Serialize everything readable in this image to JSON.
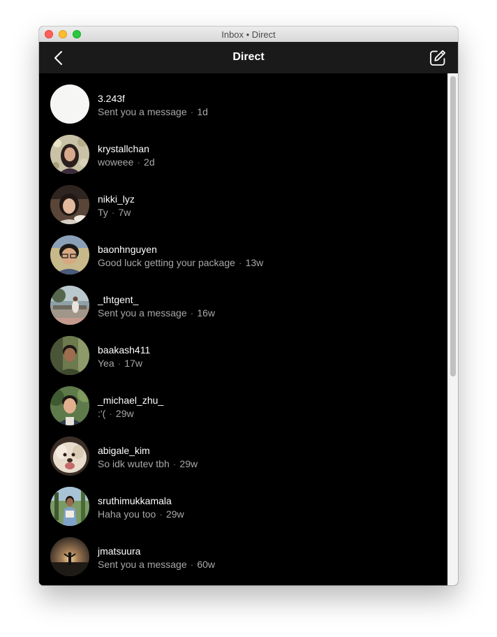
{
  "window": {
    "title": "Inbox • Direct"
  },
  "navbar": {
    "title": "Direct",
    "back_icon": "chevron-left-icon",
    "compose_icon": "compose-icon"
  },
  "threads": [
    {
      "username": "3.243f",
      "message": "Sent you a message",
      "time": "1d",
      "avatar": "blank"
    },
    {
      "username": "krystallchan",
      "message": "woweee",
      "time": "2d",
      "avatar": "photo"
    },
    {
      "username": "nikki_lyz",
      "message": "Ty",
      "time": "7w",
      "avatar": "photo"
    },
    {
      "username": "baonhnguyen",
      "message": "Good luck getting your package",
      "time": "13w",
      "avatar": "photo"
    },
    {
      "username": "_thtgent_",
      "message": "Sent you a message",
      "time": "16w",
      "avatar": "photo"
    },
    {
      "username": "baakash411",
      "message": "Yea",
      "time": "17w",
      "avatar": "photo"
    },
    {
      "username": "_michael_zhu_",
      "message": ":'(",
      "time": "29w",
      "avatar": "photo"
    },
    {
      "username": "abigale_kim",
      "message": "So idk wutev tbh",
      "time": "29w",
      "avatar": "photo"
    },
    {
      "username": "sruthimukkamala",
      "message": "Haha you too",
      "time": "29w",
      "avatar": "photo"
    },
    {
      "username": "jmatsuura",
      "message": "Sent you a message",
      "time": "60w",
      "avatar": "photo"
    }
  ],
  "colors": {
    "navbar_bg": "#1a1a1a",
    "list_bg": "#000000",
    "username": "#ffffff",
    "preview": "#a8a8a8"
  }
}
